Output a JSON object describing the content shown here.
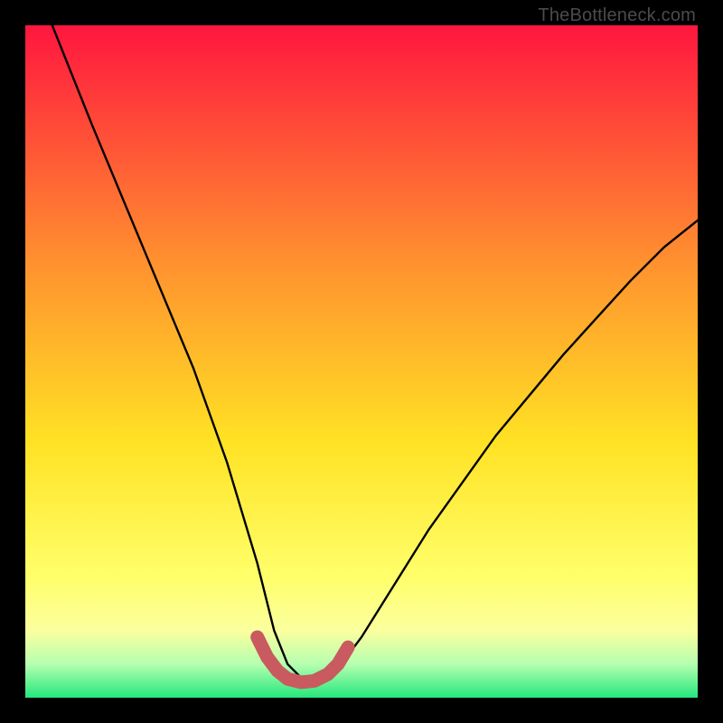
{
  "watermark": "TheBottleneck.com",
  "colors": {
    "frame": "#000000",
    "gradient_top": "#ff163f",
    "gradient_mid1": "#ff7a2f",
    "gradient_mid2": "#ffe224",
    "gradient_mid3": "#ffff8a",
    "gradient_band_light": "#f2ffb8",
    "gradient_bottom": "#24e77d",
    "curve": "#000000",
    "marker": "#c95a60"
  },
  "chart_data": {
    "type": "line",
    "title": "",
    "xlabel": "",
    "ylabel": "",
    "x_range_pct": [
      0,
      100
    ],
    "y_range_pct": [
      0,
      100
    ],
    "series": [
      {
        "name": "bottleneck-curve",
        "x_pct": [
          4,
          10,
          15,
          20,
          25,
          30,
          34.5,
          37,
          39,
          41,
          43,
          45,
          47,
          50,
          55,
          60,
          65,
          70,
          75,
          80,
          85,
          90,
          95,
          100
        ],
        "y_pct": [
          100,
          85,
          73,
          61,
          49,
          35,
          20,
          10,
          5,
          3,
          2.5,
          3,
          5,
          9,
          17,
          25,
          32,
          39,
          45,
          51,
          56.5,
          62,
          67,
          71
        ]
      }
    ],
    "highlight_segment": {
      "name": "sweet-spot",
      "x_pct": [
        34.5,
        36,
        37.5,
        39,
        41,
        43,
        45,
        46.5,
        48
      ],
      "y_pct": [
        9,
        6,
        4,
        2.8,
        2.3,
        2.5,
        3.5,
        5,
        7.5
      ]
    },
    "gradient_stops_pct": [
      {
        "pos": 0,
        "color": "#ff163f"
      },
      {
        "pos": 35,
        "color": "#ff902f"
      },
      {
        "pos": 62,
        "color": "#ffe224"
      },
      {
        "pos": 82,
        "color": "#ffff6a"
      },
      {
        "pos": 90,
        "color": "#fbff9e"
      },
      {
        "pos": 95,
        "color": "#b6ffb0"
      },
      {
        "pos": 100,
        "color": "#24e77d"
      }
    ]
  }
}
